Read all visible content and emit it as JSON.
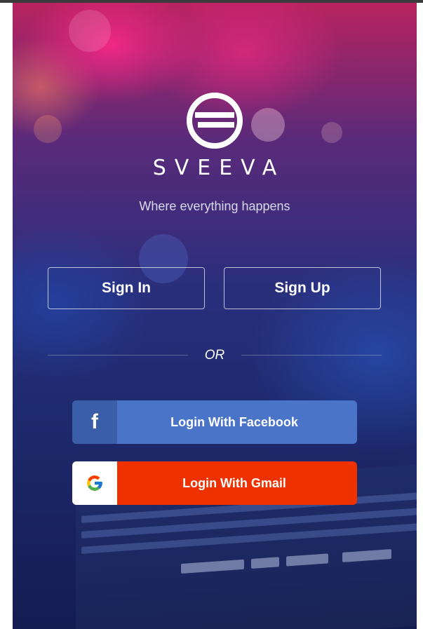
{
  "app": {
    "brand_name": "SVEEVA",
    "tagline": "Where everything happens",
    "logo_icon": "sveeva-logo-icon"
  },
  "auth": {
    "sign_in_label": "Sign In",
    "sign_up_label": "Sign Up",
    "divider_text": "OR"
  },
  "social": {
    "facebook_label": "Login With Facebook",
    "facebook_icon": "facebook-icon",
    "gmail_label": "Login With Gmail",
    "gmail_icon": "google-icon"
  },
  "colors": {
    "facebook": "#4a74c8",
    "facebook_icon_bg": "#3b5ea8",
    "gmail": "#ef3100"
  }
}
